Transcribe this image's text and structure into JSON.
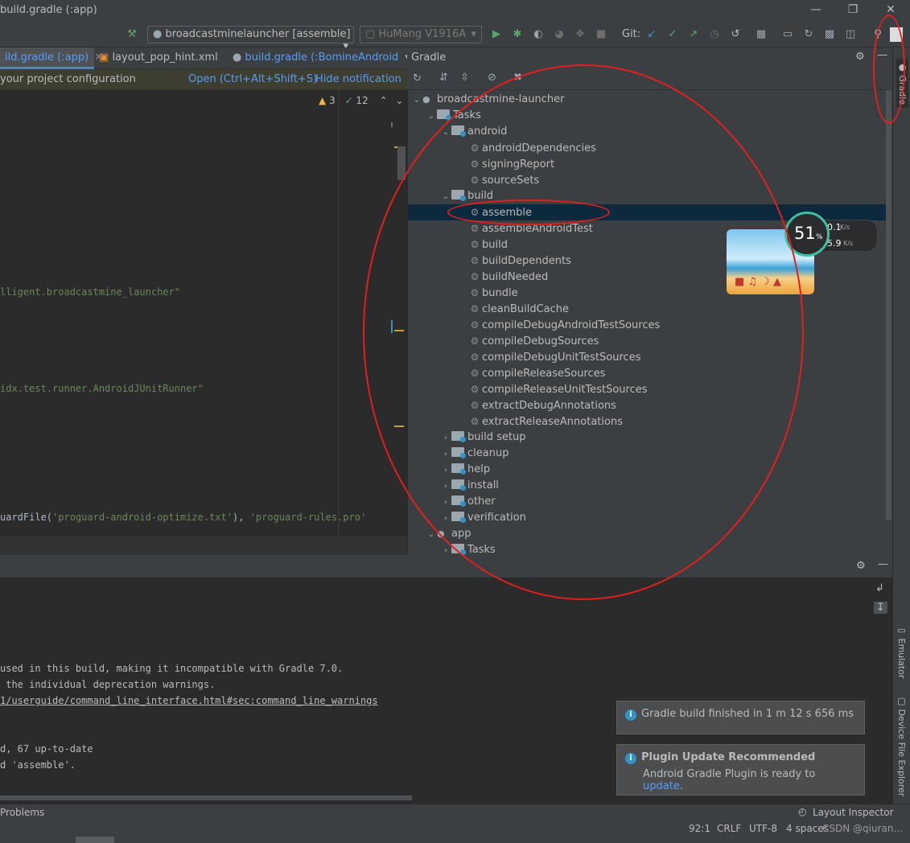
{
  "window": {
    "title": "build.gradle (:app)"
  },
  "toolbar": {
    "run_config": "broadcastminelauncher [assemble]",
    "device": "HuMang V1916A",
    "git_label": "Git:"
  },
  "tabs": [
    {
      "label": "ild.gradle (:app)"
    },
    {
      "label": "layout_pop_hint.xml"
    },
    {
      "label": "build.gradle (:BomineAndroid"
    }
  ],
  "notification": {
    "text": "your project configuration",
    "open_link": "Open (Ctrl+Alt+Shift+S)",
    "hide_link": "Hide notification"
  },
  "inspections": {
    "warnings": "3",
    "weak": "12"
  },
  "editor": {
    "line1": "lligent.broadcastmine_launcher\"",
    "line2": "idx.test.runner.AndroidJUnitRunner\"",
    "line3_pre": "uardFile(",
    "line3_s1": "'proguard-android-optimize.txt'",
    "line3_mid": "), ",
    "line3_s2": "'proguard-rules.pro'"
  },
  "gradle": {
    "title": "Gradle",
    "tree": [
      {
        "label": "broadcastmine-launcher"
      },
      {
        "label": "Tasks"
      },
      {
        "label": "android"
      },
      {
        "label": "androidDependencies"
      },
      {
        "label": "signingReport"
      },
      {
        "label": "sourceSets"
      },
      {
        "label": "build"
      },
      {
        "label": "assemble"
      },
      {
        "label": "assembleAndroidTest"
      },
      {
        "label": "build"
      },
      {
        "label": "buildDependents"
      },
      {
        "label": "buildNeeded"
      },
      {
        "label": "bundle"
      },
      {
        "label": "cleanBuildCache"
      },
      {
        "label": "compileDebugAndroidTestSources"
      },
      {
        "label": "compileDebugSources"
      },
      {
        "label": "compileDebugUnitTestSources"
      },
      {
        "label": "compileReleaseSources"
      },
      {
        "label": "compileReleaseUnitTestSources"
      },
      {
        "label": "extractDebugAnnotations"
      },
      {
        "label": "extractReleaseAnnotations"
      },
      {
        "label": "build setup"
      },
      {
        "label": "cleanup"
      },
      {
        "label": "help"
      },
      {
        "label": "install"
      },
      {
        "label": "other"
      },
      {
        "label": "verification"
      },
      {
        "label": "app"
      },
      {
        "label": "Tasks"
      }
    ]
  },
  "net_widget": {
    "percent": "51",
    "percent_unit": "%",
    "up": "0.1",
    "down": "5.9",
    "unit": "K/s"
  },
  "side_tabs": {
    "gradle": "Gradle",
    "emulator": "Emulator",
    "device_explorer": "Device File Explorer"
  },
  "console": {
    "line1": "used in this build, making it incompatible with Gradle 7.0.",
    "line2": " the individual deprecation warnings.",
    "line3": "1/userguide/command_line_interface.html#sec:command_line_warnings",
    "line4": "d, 67 up-to-date",
    "line5": "d 'assemble'."
  },
  "balloons": {
    "build_finished": "Gradle build finished in 1 m 12 s 656 ms",
    "plugin_title": "Plugin Update Recommended",
    "plugin_text": "Android Gradle Plugin is ready to ",
    "plugin_link": "update",
    "plugin_end": "."
  },
  "statusbar": {
    "problems": "Problems",
    "layout_inspector": "Layout Inspector",
    "position": "92:1",
    "line_sep": "CRLF",
    "encoding": "UTF-8",
    "indent": "4 spaces",
    "watermark": "CSDN @qiuran..."
  },
  "colors": {
    "annotation": "#e0201c",
    "selection": "#0d293e",
    "link": "#589df6"
  }
}
